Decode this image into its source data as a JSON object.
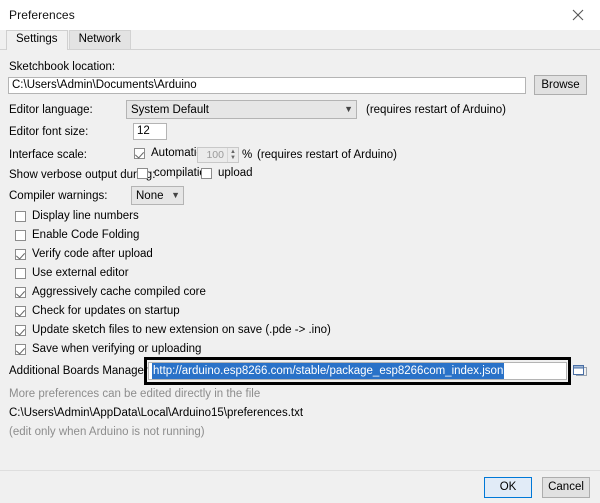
{
  "window": {
    "title": "Preferences",
    "close_icon": "close-icon"
  },
  "tabs": [
    {
      "label": "Settings",
      "active": true
    },
    {
      "label": "Network",
      "active": false
    }
  ],
  "settings": {
    "sketchbook": {
      "label": "Sketchbook location:",
      "value": "C:\\Users\\Admin\\Documents\\Arduino",
      "browse_label": "Browse"
    },
    "editor_language": {
      "label": "Editor language:",
      "value": "System Default",
      "note": "(requires restart of Arduino)",
      "caret_icon": "chevron-down-icon"
    },
    "editor_font_size": {
      "label": "Editor font size:",
      "value": "12"
    },
    "interface_scale": {
      "label": "Interface scale:",
      "automatic_label": "Automatic",
      "automatic_checked": true,
      "percent_value": "100",
      "percent_suffix": "%",
      "note": "(requires restart of Arduino)"
    },
    "verbose_output": {
      "label": "Show verbose output during:",
      "compilation_label": "compilation",
      "compilation_checked": false,
      "upload_label": "upload",
      "upload_checked": false
    },
    "compiler_warnings": {
      "label": "Compiler warnings:",
      "value": "None",
      "caret_icon": "chevron-down-icon"
    },
    "checkboxes": [
      {
        "label": "Display line numbers",
        "checked": false
      },
      {
        "label": "Enable Code Folding",
        "checked": false
      },
      {
        "label": "Verify code after upload",
        "checked": true
      },
      {
        "label": "Use external editor",
        "checked": false
      },
      {
        "label": "Aggressively cache compiled core",
        "checked": true
      },
      {
        "label": "Check for updates on startup",
        "checked": true
      },
      {
        "label": "Update sketch files to new extension on save (.pde -> .ino)",
        "checked": true
      },
      {
        "label": "Save when verifying or uploading",
        "checked": true
      }
    ],
    "boards_manager": {
      "label": "Additional Boards Manager URLs:",
      "value": "http://arduino.esp8266.com/stable/package_esp8266com_index.json",
      "expand_icon": "window-expand-icon"
    },
    "more_prefs": {
      "line1": "More preferences can be edited directly in the file",
      "line2": "C:\\Users\\Admin\\AppData\\Local\\Arduino15\\preferences.txt",
      "line3": "(edit only when Arduino is not running)"
    }
  },
  "footer": {
    "ok_label": "OK",
    "cancel_label": "Cancel"
  },
  "colors": {
    "selection_blue": "#2a72c8",
    "focus_blue": "#0078d7",
    "dialog_bg": "#f0f0f0",
    "annotation_black": "#000000"
  }
}
